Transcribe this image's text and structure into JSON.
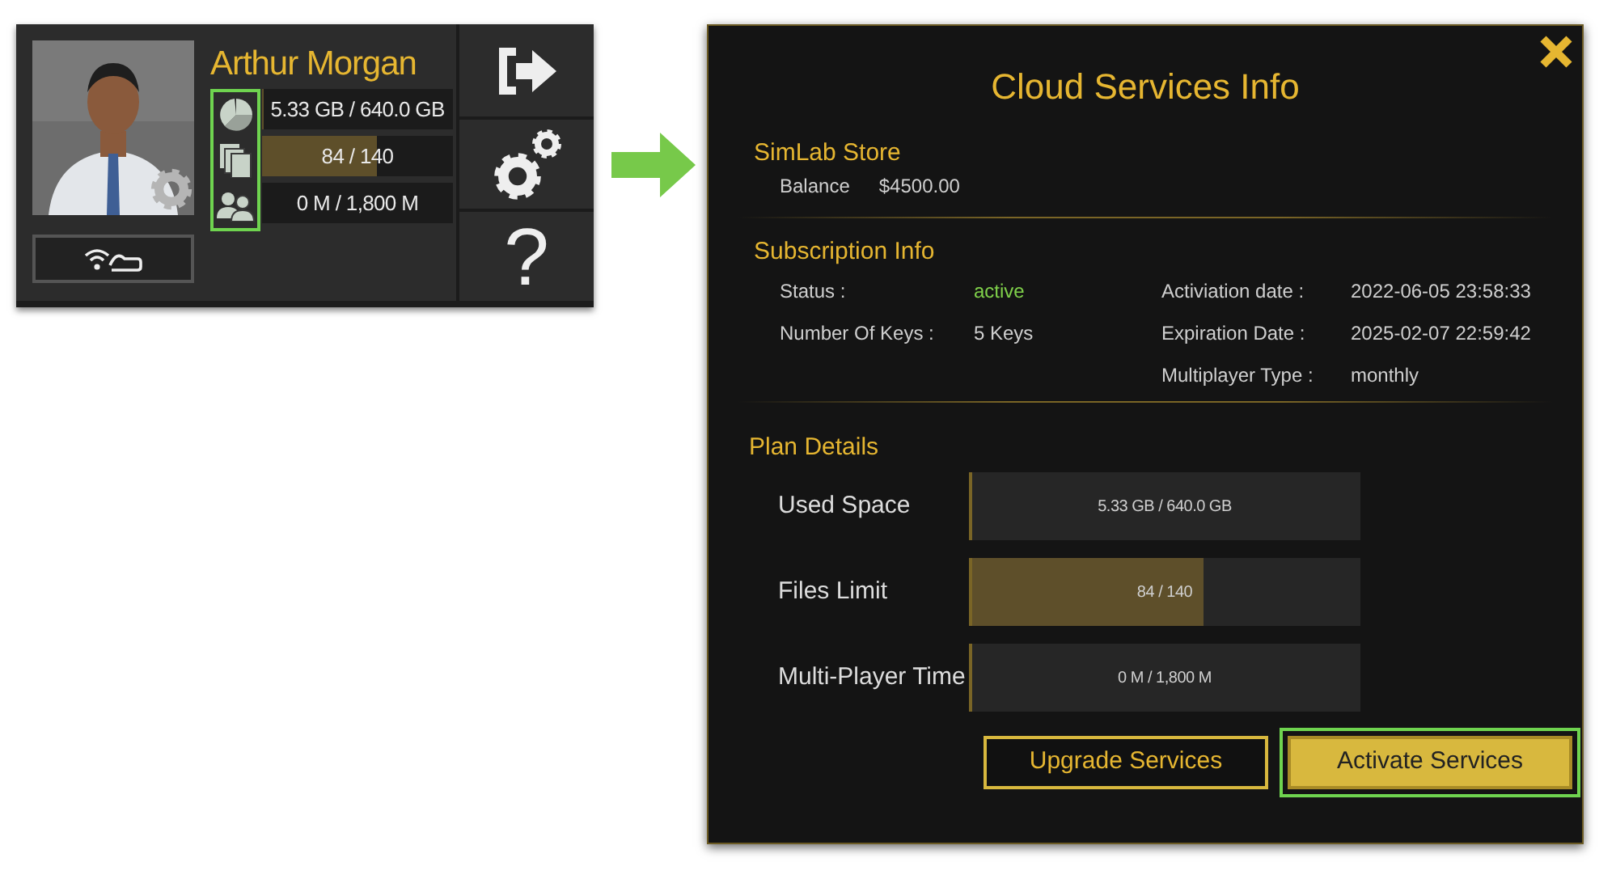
{
  "profile_card": {
    "name": "Arthur Morgan",
    "icons_highlighted": true,
    "usage": [
      {
        "kind": "storage",
        "text": "5.33 GB / 640.0 GB",
        "level": 0.01
      },
      {
        "kind": "files",
        "text": "84 / 140",
        "level": 0.6
      },
      {
        "kind": "multiplayer",
        "text": "0 M / 1,800 M",
        "level": 0
      }
    ],
    "side_buttons": [
      {
        "kind": "logout"
      },
      {
        "kind": "settings"
      },
      {
        "kind": "help",
        "label": "?"
      }
    ]
  },
  "dialog": {
    "title": "Cloud Services Info",
    "store": {
      "heading": "SimLab Store",
      "label": "Balance",
      "value": "$4500.00"
    },
    "subscription": {
      "heading": "Subscription Info",
      "left": [
        {
          "label": "Status :",
          "value": "active",
          "color": "#7fd04a"
        },
        {
          "label": "Number Of Keys :",
          "value": "5 Keys"
        }
      ],
      "right": [
        {
          "label": "Activiation date :",
          "value": "2022-06-05 23:58:33"
        },
        {
          "label": "Expiration Date :",
          "value": "2025-02-07 22:59:42"
        },
        {
          "label": "Multiplayer Type :",
          "value": "monthly"
        }
      ]
    },
    "plan": {
      "heading": "Plan Details",
      "meters": [
        {
          "label": "Used Space",
          "text": "5.33 GB / 640.0 GB",
          "level": 0.01
        },
        {
          "label": "Files Limit",
          "text": "84 / 140",
          "level": 0.6
        },
        {
          "label": "Multi-Player Time",
          "text": "0 M / 1,800 M",
          "level": 0
        }
      ]
    },
    "buttons": [
      {
        "kind": "outline",
        "label": "Upgrade Services",
        "highlighted": false
      },
      {
        "kind": "primary",
        "label": "Activate Services",
        "highlighted": true
      }
    ]
  }
}
